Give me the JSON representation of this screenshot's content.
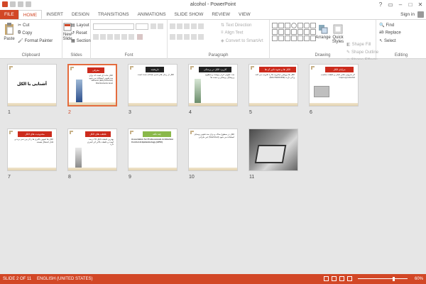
{
  "window": {
    "title": "alcohol - PowerPoint"
  },
  "tabs": [
    "FILE",
    "HOME",
    "INSERT",
    "DESIGN",
    "TRANSITIONS",
    "ANIMATIONS",
    "SLIDE SHOW",
    "REVIEW",
    "VIEW"
  ],
  "signin": "Sign in",
  "ribbon": {
    "clipboard": {
      "label": "Clipboard",
      "paste": "Paste",
      "cut": "Cut",
      "copy": "Copy",
      "format_painter": "Format Painter"
    },
    "slides": {
      "label": "Slides",
      "new_slide": "New Slide",
      "layout": "Layout",
      "reset": "Reset",
      "section": "Section"
    },
    "font": {
      "label": "Font"
    },
    "paragraph": {
      "label": "Paragraph",
      "text_direction": "Text Direction",
      "align_text": "Align Text",
      "convert_smartart": "Convert to SmartArt"
    },
    "drawing": {
      "label": "Drawing",
      "arrange": "Arrange",
      "quick_styles": "Quick Styles",
      "shape_fill": "Shape Fill",
      "shape_outline": "Shape Outline",
      "shape_effects": "Shape Effects"
    },
    "editing": {
      "label": "Editing",
      "find": "Find",
      "replace": "Replace",
      "select": "Select"
    }
  },
  "slides": [
    {
      "num": "1",
      "title": "آشنایی با الکل",
      "header": "",
      "body": ""
    },
    {
      "num": "2",
      "title": "",
      "header": "معرفی",
      "body": "الکل ماده ای است که برای ضدعفونی استفاده می شود Ethanol (Ethyl Alcohol) Disinfectants level"
    },
    {
      "num": "3",
      "title": "",
      "header": "تاریخچه",
      "body": "الکل از زمان های قدیم شناخته شده است"
    },
    {
      "num": "4",
      "title": "",
      "header": "کاربرد الکل در پزشکی",
      "body": "ضد عفونی کردن پوست و سطوح و وسایل پزشکی و دست ها"
    },
    {
      "num": "5",
      "title": "",
      "header": "الکل ها و نحوه تاثیر آن ها",
      "body": "الکل ها پروتئین میکروب ها را تخریب می کنند (BACTERICIDE) و اثر دارند"
    },
    {
      "num": "6",
      "title": "",
      "header": "مزایای الکل",
      "body": "اثر سریع و تبخیر آسان و غلظت مناسب Isopropyl alcohol"
    },
    {
      "num": "7",
      "title": "",
      "header": "محدودیت های الکل",
      "body": "الکل ها اسپور باکتری ها را از بین نمی برند و قابل اشتعال هستند"
    },
    {
      "num": "8",
      "title": "",
      "header": "غلظت های الکل",
      "body": "بهترین غلظت الکل 70 درصد است و غلظت بالاتر اثر کمتری دارد"
    },
    {
      "num": "9",
      "title": "",
      "header": "چند نکته",
      "body": "Association for Professionals in Infection Control & Epidemiology (APIC)"
    },
    {
      "num": "10",
      "title": "",
      "header": "",
      "body": "الکل در سطوح صاف و برای ضدعفونی وسایل غیر بحرانی (Sterilized) استفاده می شود"
    },
    {
      "num": "11",
      "title": "",
      "header": "",
      "body": ""
    }
  ],
  "status": {
    "slide": "SLIDE 2 OF 11",
    "language": "ENGLISH (UNITED STATES)",
    "zoom": "60%"
  },
  "colors": {
    "accent": "#d24726",
    "header_red": "#cc2b1d",
    "header_dark": "#222222",
    "header_green": "#8ab84a",
    "selection": "#e46c3e"
  }
}
